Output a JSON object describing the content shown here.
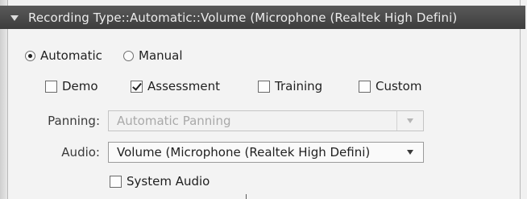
{
  "header": {
    "title": "Recording Type::Automatic::Volume (Microphone (Realtek High Defini)"
  },
  "mode": {
    "options": [
      {
        "label": "Automatic",
        "checked": true
      },
      {
        "label": "Manual",
        "checked": false
      }
    ]
  },
  "types": [
    {
      "label": "Demo",
      "checked": false
    },
    {
      "label": "Assessment",
      "checked": true
    },
    {
      "label": "Training",
      "checked": false
    },
    {
      "label": "Custom",
      "checked": false
    }
  ],
  "panning": {
    "label": "Panning:",
    "value": "Automatic Panning",
    "disabled": true
  },
  "audio": {
    "label": "Audio:",
    "value": "Volume (Microphone (Realtek High Defini)"
  },
  "system_audio": {
    "label": "System Audio",
    "checked": false
  },
  "icons": {
    "collapse": "chevron-down-icon",
    "dropdown": "dropdown-arrow-icon"
  }
}
